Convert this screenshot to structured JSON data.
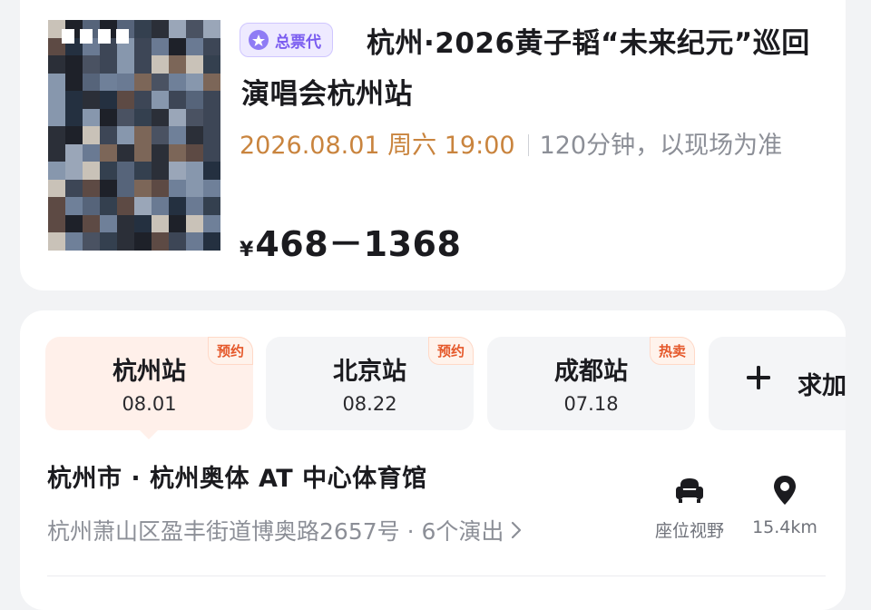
{
  "event": {
    "badge": "总票代",
    "title": "杭州·2026黄子韬“未来纪元”巡回演唱会杭州站",
    "date": "2026.08.01 周六 19:00",
    "duration": "120分钟，以现场为准",
    "currency": "¥",
    "price_range": "468－1368"
  },
  "sessions": {
    "tabs": [
      {
        "name": "杭州站",
        "date": "08.01",
        "tag": "预约"
      },
      {
        "name": "北京站",
        "date": "08.22",
        "tag": "预约"
      },
      {
        "name": "成都站",
        "date": "07.18",
        "tag": "热卖"
      }
    ],
    "add_label": "求加"
  },
  "venue": {
    "name": "杭州市 · 杭州奥体 AT 中心体育馆",
    "address": "杭州萧山区盈丰街道博奥路2657号 · 6个演出",
    "seat_view_label": "座位视野",
    "distance": "15.4km"
  },
  "colors": {
    "accent_orange": "#c9843e",
    "tag_red": "#e5582a",
    "badge_purple": "#7a5cf0"
  },
  "icons": {
    "badge": "agent-badge-icon",
    "add": "plus-icon",
    "seat": "armchair-icon",
    "location": "map-pin-icon",
    "chevron": "chevron-right-icon"
  }
}
